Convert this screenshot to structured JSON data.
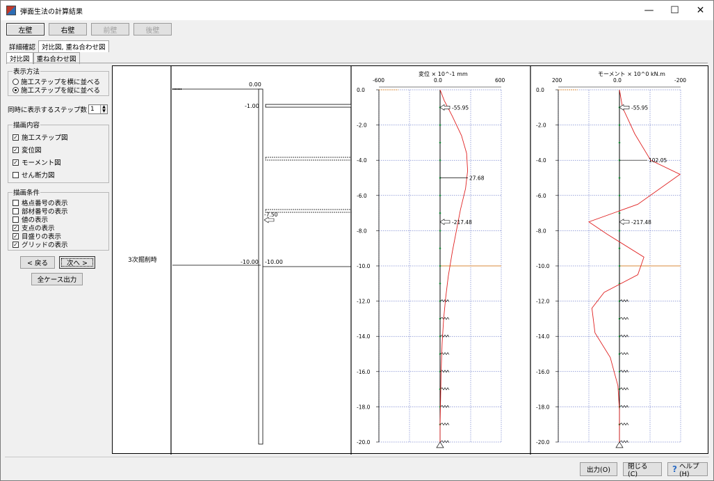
{
  "window": {
    "title": "弾面生法の計算結果",
    "min": "—",
    "max": "☐",
    "close": "✕"
  },
  "walls": {
    "left": "左壁",
    "right": "右壁",
    "front": "前壁",
    "back": "後壁"
  },
  "tabs": {
    "detail": "詳細確認",
    "compare": "対比図, 重ね合わせ図",
    "compare2": "対比図",
    "overlay": "重ね合わせ図"
  },
  "display_method": {
    "legend": "表示方法",
    "options": [
      "施工ステップを横に並べる",
      "施工ステップを縦に並べる"
    ],
    "selected": 1
  },
  "step_count": {
    "label": "同時に表示するステップ数",
    "value": "1"
  },
  "draw_content": {
    "legend": "描画内容",
    "items": [
      {
        "label": "施工ステップ図",
        "checked": true
      },
      {
        "label": "変位図",
        "checked": true
      },
      {
        "label": "モーメント図",
        "checked": true
      },
      {
        "label": "せん断力図",
        "checked": false
      }
    ]
  },
  "draw_conditions": {
    "legend": "描画条件",
    "items": [
      {
        "label": "格点番号の表示",
        "checked": false
      },
      {
        "label": "部材番号の表示",
        "checked": false
      },
      {
        "label": "値の表示",
        "checked": false
      },
      {
        "label": "支点の表示",
        "checked": true
      },
      {
        "label": "目盛りの表示",
        "checked": true
      },
      {
        "label": "グリッドの表示",
        "checked": true
      }
    ]
  },
  "nav": {
    "back": "< 戻る",
    "next": "次へ >",
    "all_output": "全ケース出力"
  },
  "bottom": {
    "output": "出力(O)",
    "close": "閉じる(C)",
    "help": "ヘルプ(H)"
  },
  "step_diagram": {
    "stage_label": "3次掘削時",
    "levels": [
      "0.00",
      "-1.00",
      "-7.50",
      "-10.00",
      "-10.00"
    ]
  },
  "chart_data": [
    {
      "type": "line",
      "title": "変位 × 10^-1 mm",
      "x_ticks": [
        "-600",
        "0.0",
        "600"
      ],
      "xlim": [
        -600,
        600
      ],
      "y_ticks": [
        "0.0",
        "-2.0",
        "-4.0",
        "-6.0",
        "-8.0",
        "-10.0",
        "-12.0",
        "-14.0",
        "-16.0",
        "-18.0",
        "-20.0"
      ],
      "ylim": [
        -20,
        0
      ],
      "series": [
        {
          "x": [
            0,
            40,
            120,
            210,
            260,
            270,
            250,
            200,
            160,
            120,
            80,
            55,
            35,
            20,
            10,
            5,
            0,
            0
          ],
          "y": [
            0,
            -0.6,
            -1.5,
            -2.6,
            -3.6,
            -4.6,
            -5.6,
            -6.8,
            -8.0,
            -9.2,
            -10.6,
            -11.8,
            -13.0,
            -14.4,
            -16.0,
            -17.6,
            -19.0,
            -20.0
          ]
        }
      ],
      "annotations": [
        {
          "text": "-55.95",
          "x": 0,
          "y": -1.0
        },
        {
          "text": "27.68",
          "x": 0,
          "y": -5.0
        },
        {
          "text": "-217.48",
          "x": 0,
          "y": -7.5
        }
      ]
    },
    {
      "type": "line",
      "title": "モーメント × 10^0 kN.m",
      "x_ticks": [
        "200",
        "0.0",
        "-200"
      ],
      "xlim": [
        200,
        -200
      ],
      "y_ticks": [
        "0.0",
        "-2.0",
        "-4.0",
        "-6.0",
        "-8.0",
        "-10.0",
        "-12.0",
        "-14.0",
        "-16.0",
        "-18.0",
        "-20.0"
      ],
      "ylim": [
        -20,
        0
      ],
      "series": [
        {
          "x": [
            0,
            -10,
            -50,
            -102,
            -198,
            -60,
            100,
            40,
            -80,
            -60,
            50,
            90,
            80,
            30,
            5,
            0,
            0
          ],
          "y": [
            0,
            -1.0,
            -2.5,
            -4.0,
            -4.8,
            -6.5,
            -7.5,
            -8.2,
            -9.5,
            -10.5,
            -11.5,
            -12.4,
            -13.8,
            -15.2,
            -16.8,
            -18.2,
            -20.0
          ]
        }
      ],
      "annotations": [
        {
          "text": "-55.95",
          "x": 0,
          "y": -1.0
        },
        {
          "text": "102.05",
          "x": 0,
          "y": -4.0
        },
        {
          "text": "-217.48",
          "x": 0,
          "y": -7.5
        }
      ]
    }
  ]
}
